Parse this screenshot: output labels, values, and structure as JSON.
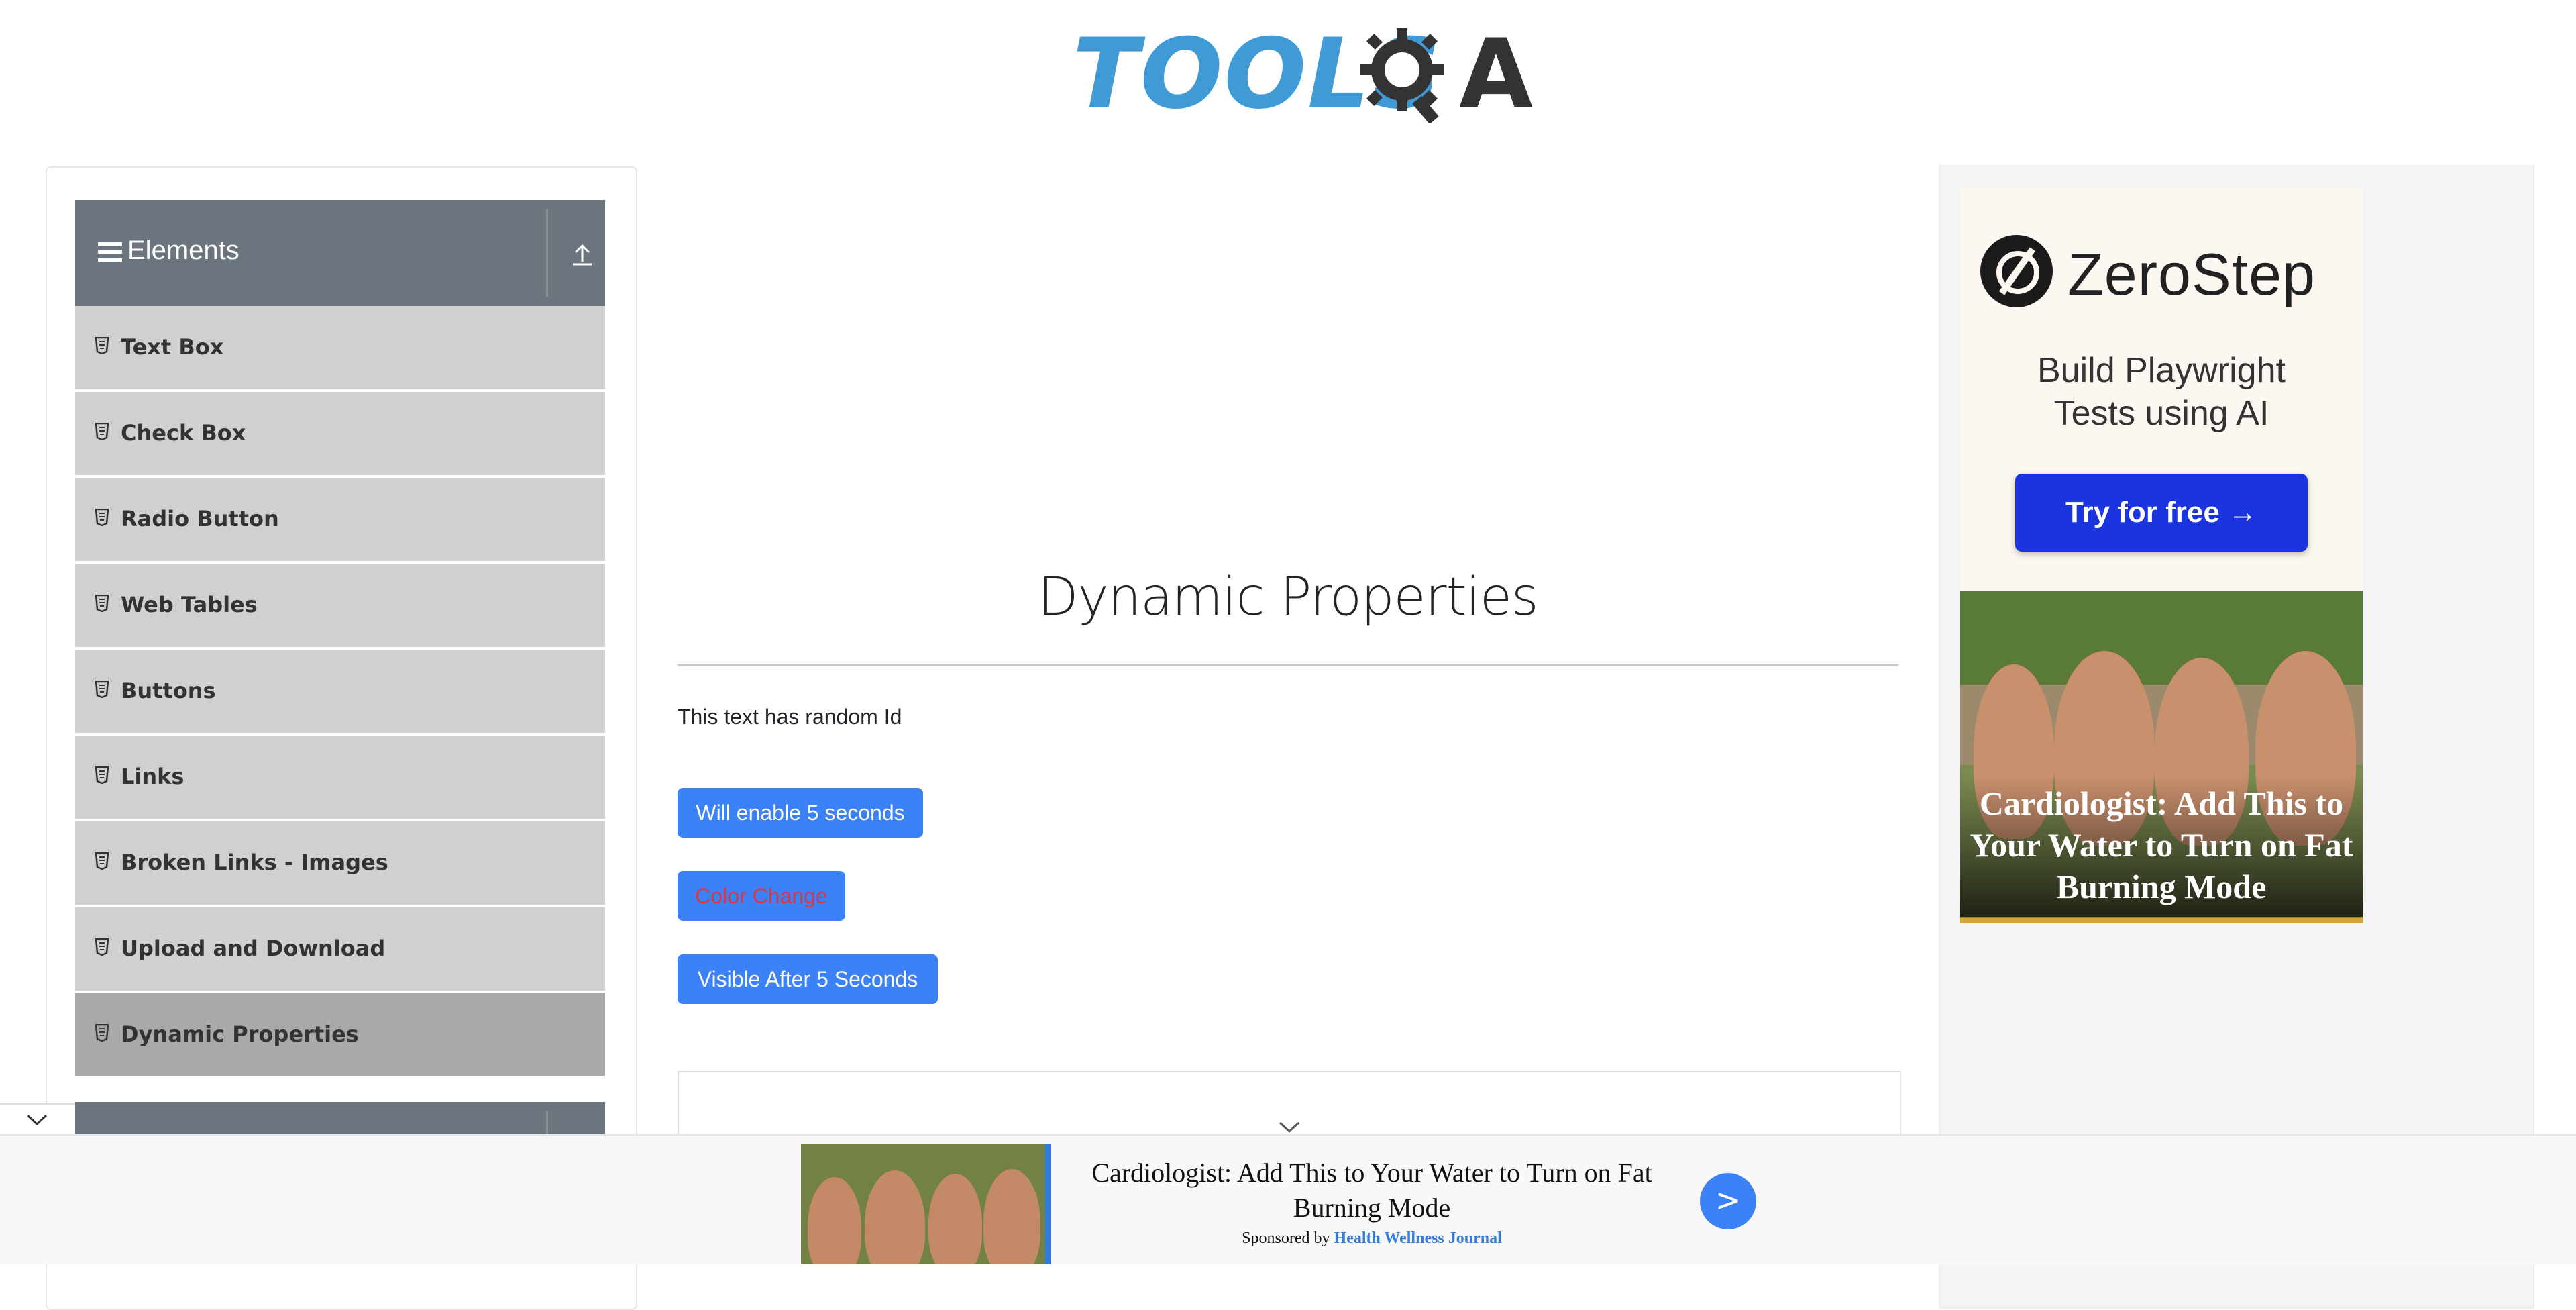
{
  "logo": {
    "text_tools": "TOOLS",
    "text_qa": "A"
  },
  "sidebar": {
    "group_title": "Elements",
    "items": [
      {
        "label": "Text Box"
      },
      {
        "label": "Check Box"
      },
      {
        "label": "Radio Button"
      },
      {
        "label": "Web Tables"
      },
      {
        "label": "Buttons"
      },
      {
        "label": "Links"
      },
      {
        "label": "Broken Links - Images"
      },
      {
        "label": "Upload and Download"
      },
      {
        "label": "Dynamic Properties",
        "active": true
      }
    ]
  },
  "main": {
    "title": "Dynamic Properties",
    "random_text": "This text has random Id",
    "buttons": {
      "enable": "Will enable 5 seconds",
      "color_change": "Color Change",
      "visible_after": "Visible After 5 Seconds"
    }
  },
  "right_ad": {
    "brand": "ZeroStep",
    "tagline_line1": "Build Playwright",
    "tagline_line2": "Tests using AI",
    "cta": "Try for free →",
    "photo_caption": "Cardiologist: Add This to Your Water to Turn on Fat Burning Mode"
  },
  "bottom_ad": {
    "headline": "Cardiologist: Add This to Your Water to Turn on Fat Burning Mode",
    "sponsored_prefix": "Sponsored by",
    "sponsor": "Health Wellness Journal",
    "go_label": ">"
  },
  "colors": {
    "primary_button": "#3b82f6",
    "sidebar_header": "#6c757d",
    "sidebar_item": "#d0d0d0",
    "sidebar_item_active": "#a9a9a9",
    "color_change_text": "#dc3545",
    "logo_blue": "#3f9ad6",
    "zerostep_cta": "#1a34e0"
  }
}
